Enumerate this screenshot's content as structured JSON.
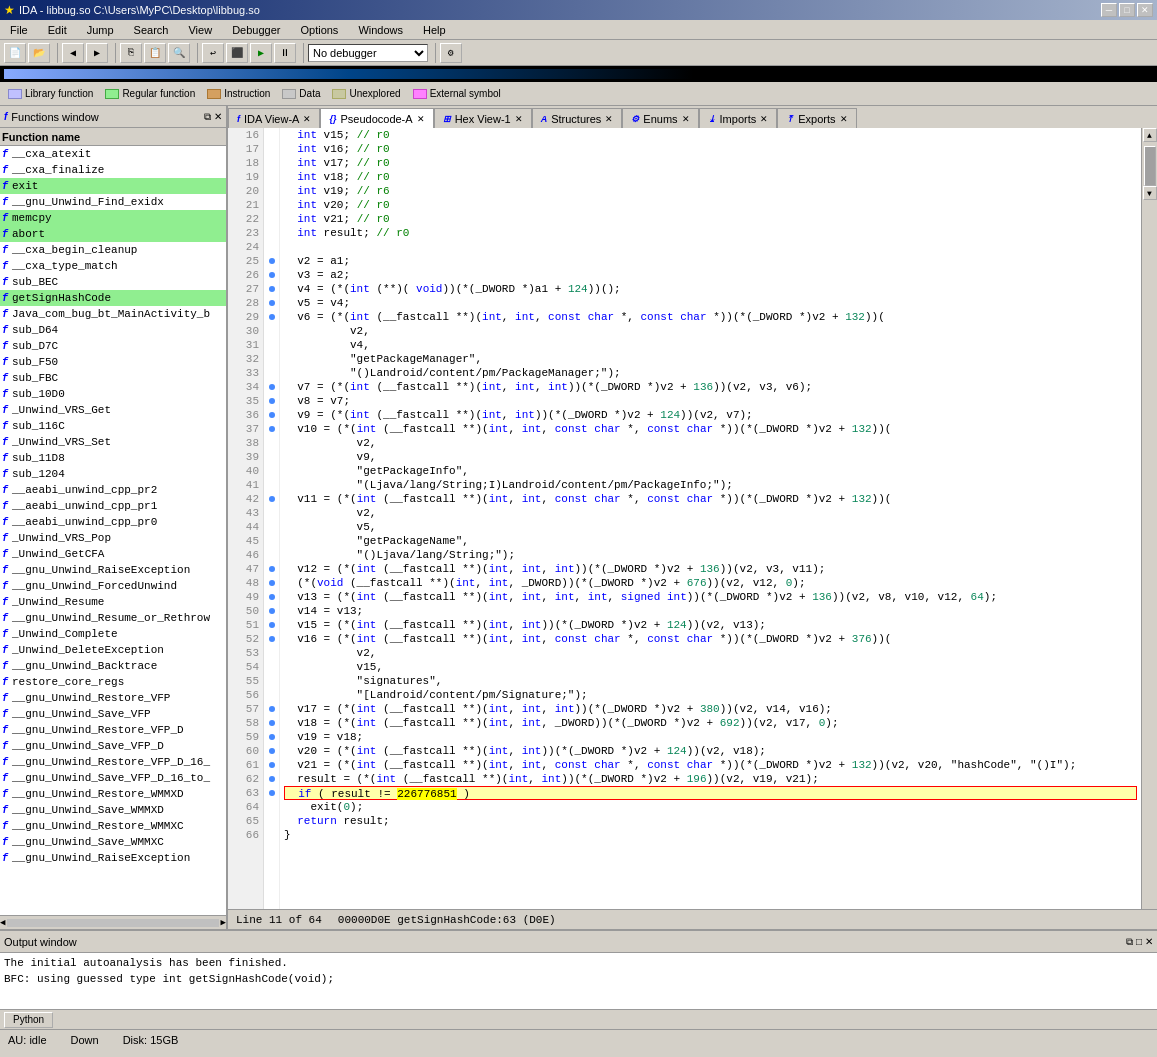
{
  "titlebar": {
    "title": "IDA - libbug.so C:\\Users\\MyPC\\Desktop\\libbug.so",
    "icon": "★"
  },
  "menubar": {
    "items": [
      "File",
      "Edit",
      "Jump",
      "Search",
      "View",
      "Debugger",
      "Options",
      "Windows",
      "Help"
    ]
  },
  "legend": {
    "items": [
      {
        "label": "Library function",
        "color": "#c0c0ff"
      },
      {
        "label": "Regular function",
        "color": "#90ee90"
      },
      {
        "label": "Instruction",
        "color": "#d4a060"
      },
      {
        "label": "Data",
        "color": "#c8c8c8"
      },
      {
        "label": "Unexplored",
        "color": "#c8c8a0"
      },
      {
        "label": "External symbol",
        "color": "#ff80ff"
      }
    ]
  },
  "functions_panel": {
    "title": "Functions window",
    "header": "Function name",
    "functions": [
      {
        "name": "__cxa_atexit",
        "highlight": false
      },
      {
        "name": "__cxa_finalize",
        "highlight": false
      },
      {
        "name": "exit",
        "highlight": true
      },
      {
        "name": "__gnu_Unwind_Find_exidx",
        "highlight": false
      },
      {
        "name": "memcpy",
        "highlight": true
      },
      {
        "name": "abort",
        "highlight": true
      },
      {
        "name": "__cxa_begin_cleanup",
        "highlight": false
      },
      {
        "name": "__cxa_type_match",
        "highlight": false
      },
      {
        "name": "sub_BEC",
        "highlight": false
      },
      {
        "name": "getSignHashCode",
        "highlight": true
      },
      {
        "name": "Java_com_bug_bt_MainActivity_b",
        "highlight": false
      },
      {
        "name": "sub_D64",
        "highlight": false
      },
      {
        "name": "sub_D7C",
        "highlight": false
      },
      {
        "name": "sub_F50",
        "highlight": false
      },
      {
        "name": "sub_FBC",
        "highlight": false
      },
      {
        "name": "sub_10D0",
        "highlight": false
      },
      {
        "name": "_Unwind_VRS_Get",
        "highlight": false
      },
      {
        "name": "sub_116C",
        "highlight": false
      },
      {
        "name": "_Unwind_VRS_Set",
        "highlight": false
      },
      {
        "name": "sub_11D8",
        "highlight": false
      },
      {
        "name": "sub_1204",
        "highlight": false
      },
      {
        "name": "__aeabi_unwind_cpp_pr2",
        "highlight": false
      },
      {
        "name": "__aeabi_unwind_cpp_pr1",
        "highlight": false
      },
      {
        "name": "__aeabi_unwind_cpp_pr0",
        "highlight": false
      },
      {
        "name": "_Unwind_VRS_Pop",
        "highlight": false
      },
      {
        "name": "_Unwind_GetCFA",
        "highlight": false
      },
      {
        "name": "__gnu_Unwind_RaiseException",
        "highlight": false
      },
      {
        "name": "__gnu_Unwind_ForcedUnwind",
        "highlight": false
      },
      {
        "name": "_Unwind_Resume",
        "highlight": false
      },
      {
        "name": "__gnu_Unwind_Resume_or_Rethrow",
        "highlight": false
      },
      {
        "name": "_Unwind_Complete",
        "highlight": false
      },
      {
        "name": "_Unwind_DeleteException",
        "highlight": false
      },
      {
        "name": "__gnu_Unwind_Backtrace",
        "highlight": false
      },
      {
        "name": "restore_core_regs",
        "highlight": false
      },
      {
        "name": "__gnu_Unwind_Restore_VFP",
        "highlight": false
      },
      {
        "name": "__gnu_Unwind_Save_VFP",
        "highlight": false
      },
      {
        "name": "__gnu_Unwind_Restore_VFP_D",
        "highlight": false
      },
      {
        "name": "__gnu_Unwind_Save_VFP_D",
        "highlight": false
      },
      {
        "name": "__gnu_Unwind_Restore_VFP_D_16_",
        "highlight": false
      },
      {
        "name": "__gnu_Unwind_Save_VFP_D_16_to_",
        "highlight": false
      },
      {
        "name": "__gnu_Unwind_Restore_WMMXD",
        "highlight": false
      },
      {
        "name": "__gnu_Unwind_Save_WMMXD",
        "highlight": false
      },
      {
        "name": "__gnu_Unwind_Restore_WMMXC",
        "highlight": false
      },
      {
        "name": "__gnu_Unwind_Save_WMMXC",
        "highlight": false
      },
      {
        "name": "__gnu_Unwind_RaiseException",
        "highlight": false
      }
    ]
  },
  "tabs": {
    "main": [
      {
        "label": "IDA View-A",
        "active": false,
        "icon": "f"
      },
      {
        "label": "Pseudocode-A",
        "active": true,
        "icon": "{}"
      },
      {
        "label": "Hex View-1",
        "active": false,
        "icon": "⊞"
      },
      {
        "label": "Structures",
        "active": false,
        "icon": "A"
      },
      {
        "label": "Enums",
        "active": false,
        "icon": "⚙"
      },
      {
        "label": "Imports",
        "active": false,
        "icon": "⤓"
      },
      {
        "label": "Exports",
        "active": false,
        "icon": "⤒"
      }
    ]
  },
  "code": {
    "lines": [
      {
        "num": 16,
        "dot": false,
        "text": "  int v15; // r0"
      },
      {
        "num": 17,
        "dot": false,
        "text": "  int v16; // r0"
      },
      {
        "num": 18,
        "dot": false,
        "text": "  int v17; // r0"
      },
      {
        "num": 19,
        "dot": false,
        "text": "  int v18; // r0"
      },
      {
        "num": 20,
        "dot": false,
        "text": "  int v19; // r6"
      },
      {
        "num": 21,
        "dot": false,
        "text": "  int v20; // r0"
      },
      {
        "num": 22,
        "dot": false,
        "text": "  int v21; // r0"
      },
      {
        "num": 23,
        "dot": false,
        "text": "  int result; // r0"
      },
      {
        "num": 24,
        "dot": false,
        "text": ""
      },
      {
        "num": 25,
        "dot": true,
        "text": "  v2 = a1;"
      },
      {
        "num": 26,
        "dot": true,
        "text": "  v3 = a2;"
      },
      {
        "num": 27,
        "dot": true,
        "text": "  v4 = (*(int (**)( void))(*(_DWORD *)a1 + 124))();"
      },
      {
        "num": 28,
        "dot": true,
        "text": "  v5 = v4;"
      },
      {
        "num": 29,
        "dot": true,
        "text": "  v6 = (*(int (__fastcall **)(int, int, const char *, const char *))(*(_DWORD *)v2 + 132))("
      },
      {
        "num": 30,
        "dot": false,
        "text": "          v2,"
      },
      {
        "num": 31,
        "dot": false,
        "text": "          v4,"
      },
      {
        "num": 32,
        "dot": false,
        "text": "          \"getPackageManager\","
      },
      {
        "num": 33,
        "dot": false,
        "text": "          \"()Landroid/content/pm/PackageManager;\");"
      },
      {
        "num": 34,
        "dot": true,
        "text": "  v7 = (*(int (__fastcall **)(int, int, int))(*(_DWORD *)v2 + 136))(v2, v3, v6);"
      },
      {
        "num": 35,
        "dot": true,
        "text": "  v8 = v7;"
      },
      {
        "num": 36,
        "dot": true,
        "text": "  v9 = (*(int (__fastcall **)(int, int))(*(_DWORD *)v2 + 124))(v2, v7);"
      },
      {
        "num": 37,
        "dot": true,
        "text": "  v10 = (*(int (__fastcall **)(int, int, const char *, const char *))(*(_DWORD *)v2 + 132))("
      },
      {
        "num": 38,
        "dot": false,
        "text": "           v2,"
      },
      {
        "num": 39,
        "dot": false,
        "text": "           v9,"
      },
      {
        "num": 40,
        "dot": false,
        "text": "           \"getPackageInfo\","
      },
      {
        "num": 41,
        "dot": false,
        "text": "           \"(Ljava/lang/String;I)Landroid/content/pm/PackageInfo;\");"
      },
      {
        "num": 42,
        "dot": true,
        "text": "  v11 = (*(int (__fastcall **)(int, int, const char *, const char *))(*(_DWORD *)v2 + 132))("
      },
      {
        "num": 43,
        "dot": false,
        "text": "           v2,"
      },
      {
        "num": 44,
        "dot": false,
        "text": "           v5,"
      },
      {
        "num": 45,
        "dot": false,
        "text": "           \"getPackageName\","
      },
      {
        "num": 46,
        "dot": false,
        "text": "           \"()Ljava/lang/String;\");"
      },
      {
        "num": 47,
        "dot": true,
        "text": "  v12 = (*(int (__fastcall **)(int, int, int))(*(_DWORD *)v2 + 136))(v2, v3, v11);"
      },
      {
        "num": 48,
        "dot": true,
        "text": "  (*(void (__fastcall **)(int, int, _DWORD))(*(_DWORD *)v2 + 676))(v2, v12, 0);"
      },
      {
        "num": 49,
        "dot": true,
        "text": "  v13 = (*(int (__fastcall **)(int, int, int, int, signed int))(*(_DWORD *)v2 + 136))(v2, v8, v10, v12, 64);"
      },
      {
        "num": 50,
        "dot": true,
        "text": "  v14 = v13;"
      },
      {
        "num": 51,
        "dot": true,
        "text": "  v15 = (*(int (__fastcall **)(int, int))(*(_DWORD *)v2 + 124))(v2, v13);"
      },
      {
        "num": 52,
        "dot": true,
        "text": "  v16 = (*(int (__fastcall **)(int, int, const char *, const char *))(*(_DWORD *)v2 + 376))("
      },
      {
        "num": 53,
        "dot": false,
        "text": "           v2,"
      },
      {
        "num": 54,
        "dot": false,
        "text": "           v15,"
      },
      {
        "num": 55,
        "dot": false,
        "text": "           \"signatures\","
      },
      {
        "num": 56,
        "dot": false,
        "text": "           \"[Landroid/content/pm/Signature;\");"
      },
      {
        "num": 57,
        "dot": true,
        "text": "  v17 = (*(int (__fastcall **)(int, int, int))(*(_DWORD *)v2 + 380))(v2, v14, v16);"
      },
      {
        "num": 58,
        "dot": true,
        "text": "  v18 = (*(int (__fastcall **)(int, int, _DWORD))(*(_DWORD *)v2 + 692))(v2, v17, 0);"
      },
      {
        "num": 59,
        "dot": true,
        "text": "  v19 = v18;"
      },
      {
        "num": 60,
        "dot": true,
        "text": "  v20 = (*(int (__fastcall **)(int, int))(*(_DWORD *)v2 + 124))(v2, v18);"
      },
      {
        "num": 61,
        "dot": true,
        "text": "  v21 = (*(int (__fastcall **)(int, int, const char *, const char *))(*(_DWORD *)v2 + 132))(v2, v20, \"hashCode\", \"()I\");"
      },
      {
        "num": 62,
        "dot": true,
        "text": "  result = (*(int (__fastcall **)(int, int))(*(_DWORD *)v2 + 196))(v2, v19, v21);"
      },
      {
        "num": 63,
        "dot": true,
        "text": "  if ( result != 226776851 )",
        "highlight": true
      },
      {
        "num": 64,
        "dot": false,
        "text": "    exit(0);"
      },
      {
        "num": 65,
        "dot": false,
        "text": "  return result;"
      },
      {
        "num": 66,
        "dot": false,
        "text": "}"
      }
    ]
  },
  "status_bar": {
    "line_info": "Line 11 of 64",
    "address": "00000D0E getSignHashCode:63 (D0E)"
  },
  "output": {
    "title": "Output window",
    "lines": [
      "The initial autoanalysis has been finished.",
      "BFC: using guessed type int getSignHashCode(void);"
    ]
  },
  "python_tab": "Python",
  "bottom_status": {
    "au": "AU:  idle",
    "down": "Down",
    "disk": "Disk: 15GB"
  },
  "debugger_select": "No debugger"
}
